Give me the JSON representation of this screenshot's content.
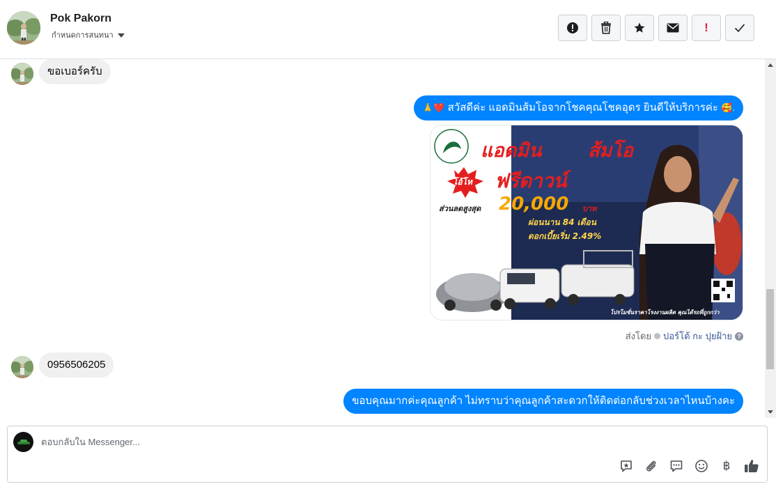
{
  "header": {
    "contact_name": "Pok Pakorn",
    "assign_label": "กำหนดการสนทนา",
    "actions": [
      {
        "icon": "alert-circle-icon",
        "label": "spam"
      },
      {
        "icon": "trash-icon",
        "label": "delete"
      },
      {
        "icon": "star-icon",
        "label": "follow up"
      },
      {
        "icon": "envelope-icon",
        "label": "mark unread"
      },
      {
        "icon": "exclamation-icon",
        "label": "!"
      },
      {
        "icon": "checkmark-icon",
        "label": "done"
      }
    ]
  },
  "messages": [
    {
      "direction": "in",
      "text": "ขอเบอร์ครับ"
    },
    {
      "direction": "out",
      "emoji_prefix": "🙏❤️",
      "text": "สวัสดีค่ะ แอดมินส้มโอจากโชคคุณโชคอุดร ยินดีให้บริการค่ะ",
      "emoji_suffix": "🥰."
    },
    {
      "direction": "out",
      "type": "image"
    },
    {
      "direction": "in",
      "text": "0956506205"
    },
    {
      "direction": "out",
      "text": "ขอบคุณมากค่ะคุณลูกค้า ไม่ทราบว่าคุณลูกค้าสะดวกให้ติดต่อกลับช่วงเวลาไหนบ้างคะ"
    }
  ],
  "promo": {
    "title": "แอดมิน",
    "name": "ส้มโอ",
    "burst": "โอ้โห",
    "headline": "ฟรีดาวน์",
    "discount_label": "ส่วนลดสูงสุด",
    "discount_amount": "20,000",
    "currency": "บาท",
    "installment": "ผ่อนนาน 84 เดือน",
    "interest": "ดอกเบี้ยเริ่ม 2.49%",
    "footer": "โปรโมชั่นราคาโรงงานผลิต คุณได้รถที่ถูกกว่า"
  },
  "sent_by": {
    "prefix": "ส่งโดย",
    "name": "ปอร์โต้ กะ ปุยฝ้าย",
    "help": "?"
  },
  "composer": {
    "placeholder": "ตอบกลับใน Messenger...",
    "currency_symbol": "฿",
    "tools": [
      "saved-reply-icon",
      "attachment-icon",
      "chat-bubble-icon",
      "emoji-icon",
      "baht-icon",
      "thumbs-up-icon"
    ]
  }
}
